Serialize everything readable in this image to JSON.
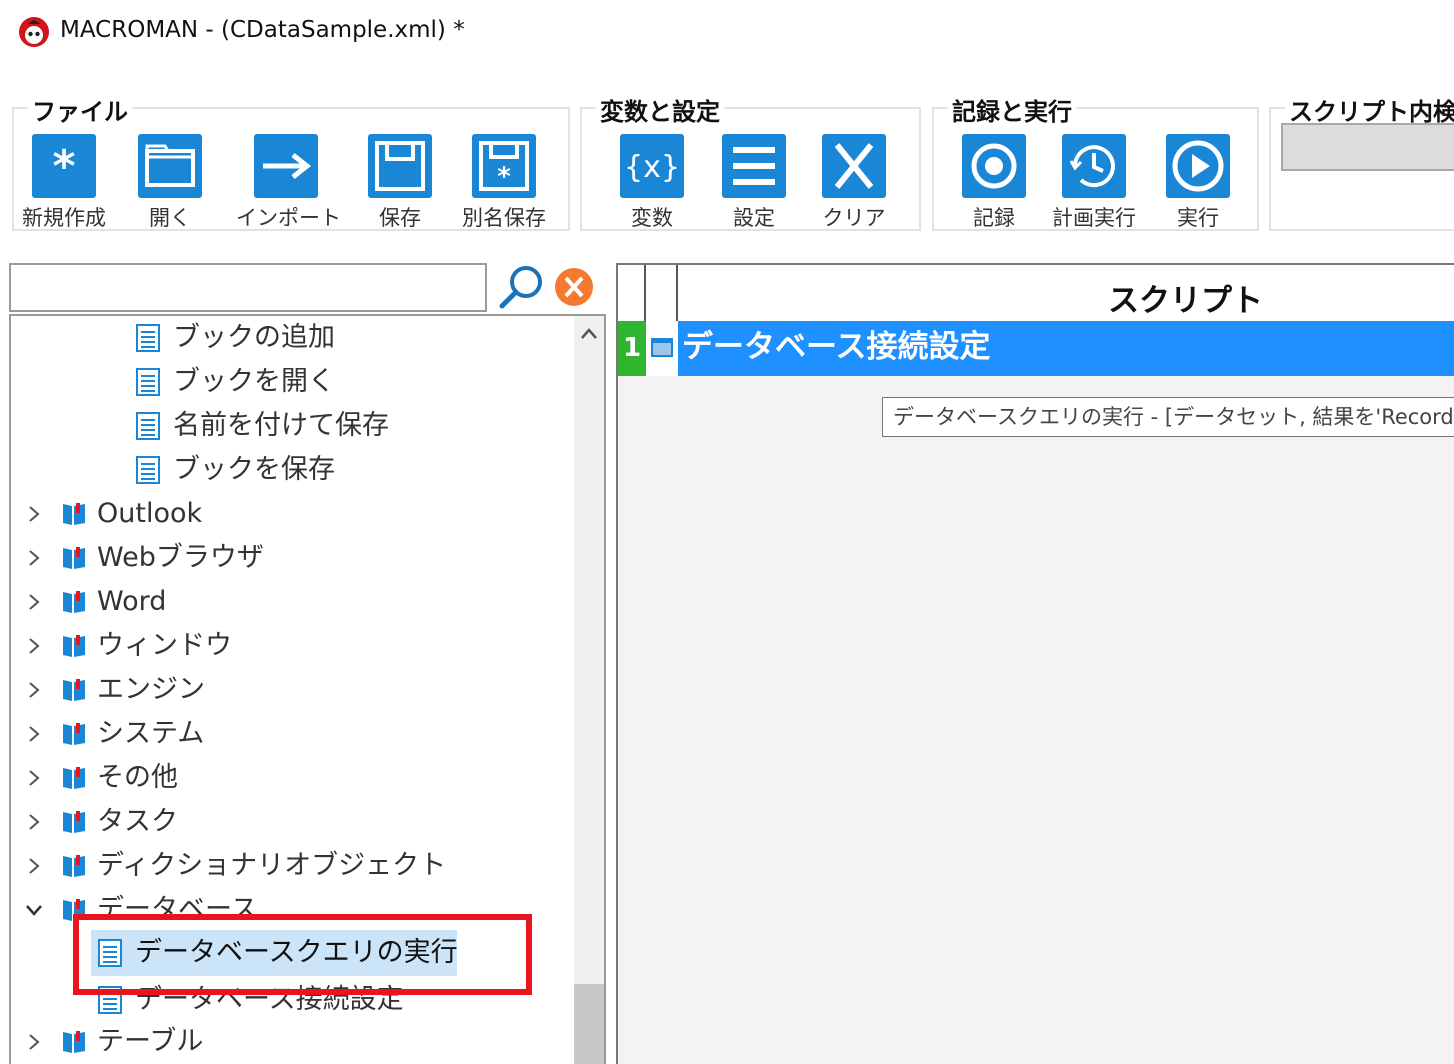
{
  "window": {
    "title": "MACROMAN - (CDataSample.xml) *"
  },
  "ribbon": {
    "file_group": {
      "label": "ファイル",
      "new": "新規作成",
      "open": "開く",
      "import": "インポート",
      "save": "保存",
      "save_as": "別名保存"
    },
    "vars_group": {
      "label": "変数と設定",
      "variables": "変数",
      "settings": "設定",
      "clear": "クリア"
    },
    "record_group": {
      "label": "記録と実行",
      "record": "記録",
      "scheduled_run": "計画実行",
      "run": "実行"
    },
    "search_group": {
      "label": "スクリプト内検"
    }
  },
  "search": {
    "value": "",
    "placeholder": ""
  },
  "tree": {
    "items": [
      {
        "label": "ブックの追加",
        "kind": "command"
      },
      {
        "label": "ブックを開く",
        "kind": "command"
      },
      {
        "label": "名前を付けて保存",
        "kind": "command"
      },
      {
        "label": "ブックを保存",
        "kind": "command"
      },
      {
        "label": "Outlook",
        "kind": "folder"
      },
      {
        "label": "Webブラウザ",
        "kind": "folder"
      },
      {
        "label": "Word",
        "kind": "folder"
      },
      {
        "label": "ウィンドウ",
        "kind": "folder"
      },
      {
        "label": "エンジン",
        "kind": "folder"
      },
      {
        "label": "システム",
        "kind": "folder"
      },
      {
        "label": "その他",
        "kind": "folder"
      },
      {
        "label": "タスク",
        "kind": "folder"
      },
      {
        "label": "ディクショナリオブジェクト",
        "kind": "folder"
      },
      {
        "label": "データベース",
        "kind": "folder-open"
      },
      {
        "label": "データベースクエリの実行",
        "kind": "command-selected"
      },
      {
        "label": "データベース接続設定",
        "kind": "command"
      },
      {
        "label": "テーブル",
        "kind": "folder"
      }
    ]
  },
  "script": {
    "column_title": "スクリプト",
    "rows": [
      {
        "number": "1",
        "text": "データベース接続設定"
      }
    ],
    "tooltip": "データベースクエリの実行 - [データセット, 結果を'Records'に追"
  },
  "colors": {
    "accent_blue": "#1e90ff",
    "icon_blue": "#1a86d6",
    "row_number_green": "#2fb52f",
    "highlight_red": "#e8141e",
    "clear_orange": "#f47a30"
  },
  "icons": {
    "app": "macroman-logo-icon",
    "search": "search-icon",
    "clear": "clear-x-icon",
    "folder": "book-folder-icon",
    "command": "document-icon"
  }
}
